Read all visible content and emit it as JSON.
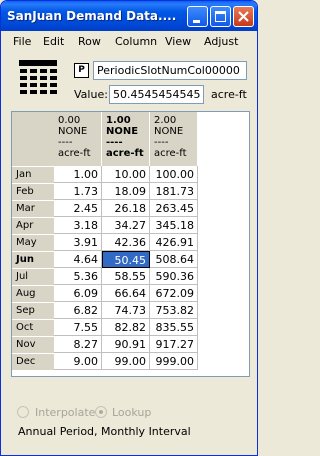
{
  "window": {
    "title": "SanJuan Demand Data...."
  },
  "menu": [
    "File",
    "Edit",
    "Row",
    "Column",
    "View",
    "Adjust"
  ],
  "slot": {
    "name": "PeriodicSlotNumCol00000",
    "value_label": "Value:",
    "value": "50.4545454545",
    "value_units": "acre-ft",
    "p_button": "P"
  },
  "table": {
    "columns": [
      {
        "value": "0.00",
        "none": "NONE",
        "dash": "----",
        "units": "acre-ft"
      },
      {
        "value": "1.00",
        "none": "NONE",
        "dash": "----",
        "units": "acre-ft"
      },
      {
        "value": "2.00",
        "none": "NONE",
        "dash": "----",
        "units": "acre-ft"
      }
    ],
    "rows": [
      {
        "label": "Jan",
        "values": [
          "1.00",
          "10.00",
          "100.00"
        ]
      },
      {
        "label": "Feb",
        "values": [
          "1.73",
          "18.09",
          "181.73"
        ]
      },
      {
        "label": "Mar",
        "values": [
          "2.45",
          "26.18",
          "263.45"
        ]
      },
      {
        "label": "Apr",
        "values": [
          "3.18",
          "34.27",
          "345.18"
        ]
      },
      {
        "label": "May",
        "values": [
          "3.91",
          "42.36",
          "426.91"
        ]
      },
      {
        "label": "Jun",
        "values": [
          "4.64",
          "50.45",
          "508.64"
        ]
      },
      {
        "label": "Jul",
        "values": [
          "5.36",
          "58.55",
          "590.36"
        ]
      },
      {
        "label": "Aug",
        "values": [
          "6.09",
          "66.64",
          "672.09"
        ]
      },
      {
        "label": "Sep",
        "values": [
          "6.82",
          "74.73",
          "753.82"
        ]
      },
      {
        "label": "Oct",
        "values": [
          "7.55",
          "82.82",
          "835.55"
        ]
      },
      {
        "label": "Nov",
        "values": [
          "8.27",
          "90.91",
          "917.27"
        ]
      },
      {
        "label": "Dec",
        "values": [
          "9.00",
          "99.00",
          "999.00"
        ]
      }
    ],
    "selected_row": 5,
    "selected_col": 1
  },
  "options": {
    "interpolate": "Interpolate",
    "lookup": "Lookup"
  },
  "status": "Annual Period, Monthly Interval",
  "colors": {
    "title_bar": "#0058e6",
    "selection": "#316ac5",
    "header_bg": "#d8d5c7"
  }
}
